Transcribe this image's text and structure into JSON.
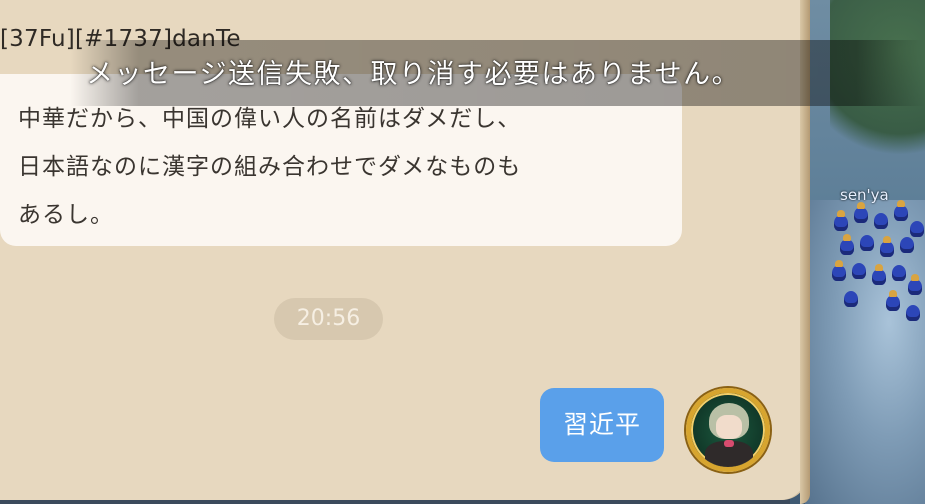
{
  "system_notice": "メッセージ送信失敗、取り消す必要はありません。",
  "game": {
    "nearby_player_name": "sen'ya"
  },
  "chat": {
    "incoming": {
      "sender": "[37Fu][#1737]danTe",
      "lines": [
        "中華だから、中国の偉い人の名前はダメだし、",
        "日本語なのに漢字の組み合わせでダメなものも",
        "あるし。"
      ]
    },
    "timestamp": "20:56",
    "outgoing": {
      "text": "習近平"
    }
  }
}
